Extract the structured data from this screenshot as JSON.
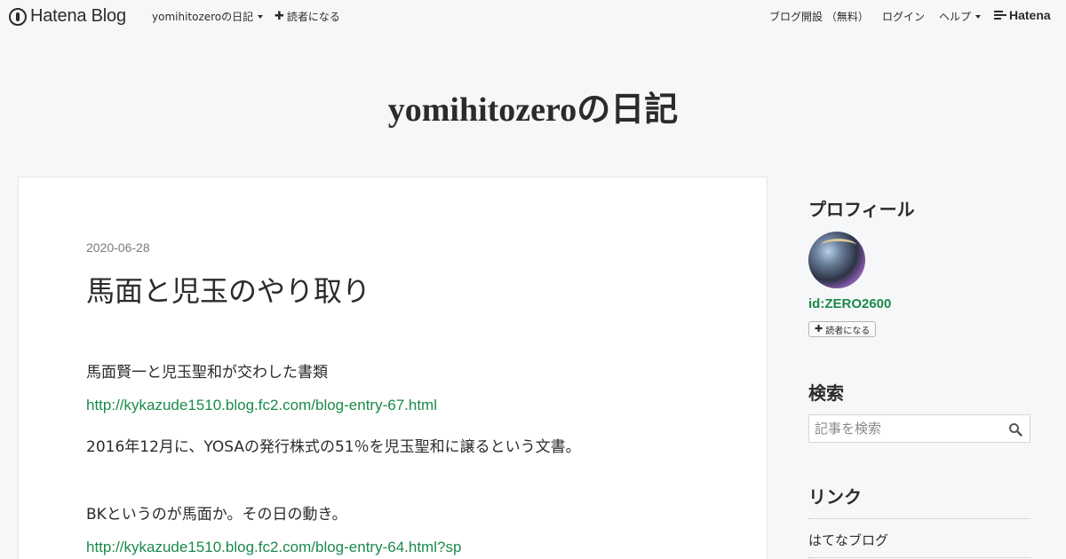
{
  "header": {
    "logo_text": "Hatena Blog",
    "blog_menu": "yomihitozeroの日記",
    "follow_label": "読者になる",
    "signup_label": "ブログ開設 （無料）",
    "login_label": "ログイン",
    "help_label": "ヘルプ",
    "brand_text": "Hatena"
  },
  "blog": {
    "title": "yomihitozeroの日記"
  },
  "entry": {
    "date": "2020-06-28",
    "title": "馬面と児玉のやり取り",
    "paragraphs": [
      "馬面賢一と児玉聖和が交わした書類",
      "http://kykazude1510.blog.fc2.com/blog-entry-67.html",
      "2016年12月に、YOSAの発行株式の51％を児玉聖和に譲るという文書。",
      "BKというのが馬面か。その日の動き。",
      "http://kykazude1510.blog.fc2.com/blog-entry-64.html?sp"
    ]
  },
  "sidebar": {
    "profile_heading": "プロフィール",
    "profile_id": "id:ZERO2600",
    "follow_button": "読者になる",
    "search_heading": "検索",
    "search_placeholder": "記事を検索",
    "links_heading": "リンク",
    "links": [
      "はてなブログ"
    ]
  },
  "colors": {
    "link": "#1a8a4a",
    "background": "#f6f7f8",
    "text": "#2b2b2b"
  }
}
